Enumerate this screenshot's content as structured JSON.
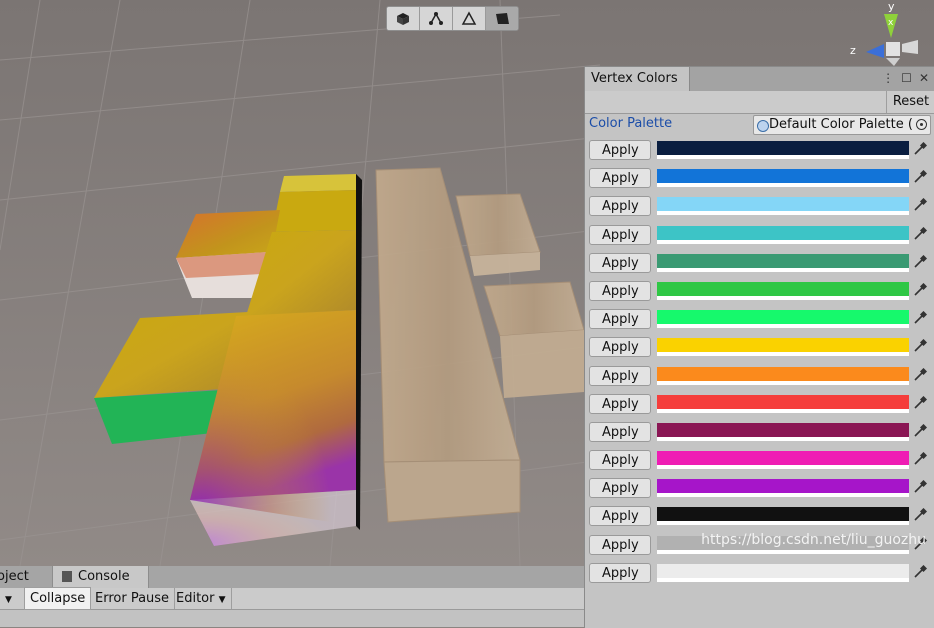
{
  "scene_toolbar": {
    "tools": [
      {
        "name": "cube-icon"
      },
      {
        "name": "vertex-icon"
      },
      {
        "name": "edge-icon"
      },
      {
        "name": "face-icon"
      }
    ]
  },
  "gizmo": {
    "y_label": "y",
    "z_label": "z",
    "x_label": "x"
  },
  "console": {
    "tab_project": "roject",
    "tab_console": "Console",
    "collapse": "Collapse",
    "error_pause": "Error Pause",
    "editor": "Editor"
  },
  "vertex_colors": {
    "title": "Vertex Colors",
    "reset": "Reset",
    "palette_label": "Color Palette",
    "palette_value": "Default Color Palette (",
    "apply_label": "Apply",
    "colors": [
      {
        "hex": "#0a1e40"
      },
      {
        "hex": "#1274d8"
      },
      {
        "hex": "#84d6f7"
      },
      {
        "hex": "#3dc4c6"
      },
      {
        "hex": "#3a9a73"
      },
      {
        "hex": "#2fc745"
      },
      {
        "hex": "#16f96c"
      },
      {
        "hex": "#fad200"
      },
      {
        "hex": "#fb8a1c"
      },
      {
        "hex": "#f53d3b"
      },
      {
        "hex": "#8a1654"
      },
      {
        "hex": "#ef1db4"
      },
      {
        "hex": "#a615c9"
      },
      {
        "hex": "#111111"
      },
      {
        "hex": "#b1b1b1"
      },
      {
        "hex": "#ececec"
      }
    ]
  },
  "watermark": "https://blog.csdn.net/liu_guozhu"
}
